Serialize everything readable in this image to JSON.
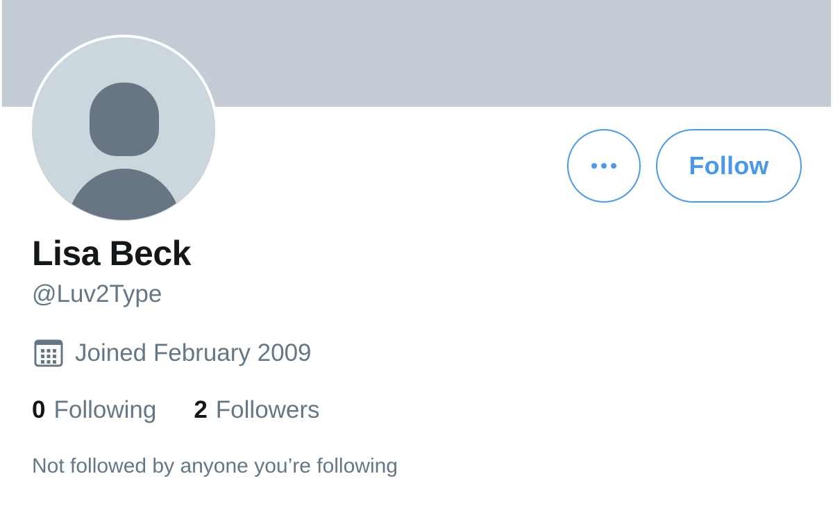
{
  "profile": {
    "name": "Lisa Beck",
    "handle": "@Luv2Type",
    "joined": "Joined February 2009",
    "following_count": "0",
    "following_label": "Following",
    "followers_count": "2",
    "followers_label": "Followers",
    "follow_note": "Not followed by anyone you’re following"
  },
  "actions": {
    "more_label": "•••",
    "follow_label": "Follow"
  },
  "icons": {
    "more": "more-horizontal-icon",
    "calendar": "calendar-icon",
    "avatar": "default-avatar-icon"
  },
  "colors": {
    "accent": "#4a99e9",
    "banner": "#c4cdd5",
    "text_primary": "#14171a",
    "text_secondary": "#657786"
  }
}
